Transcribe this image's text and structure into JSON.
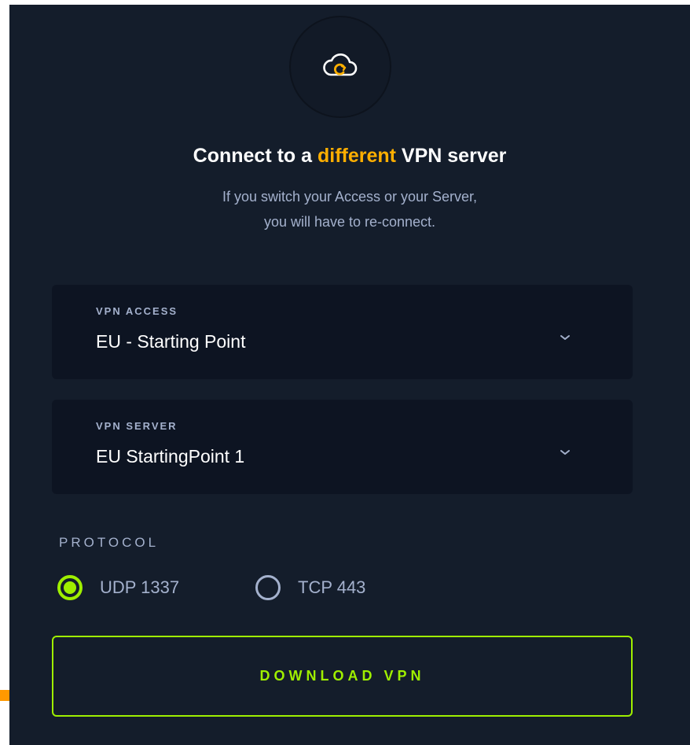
{
  "header": {
    "icon": "cloud-refresh-icon",
    "title_prefix": "Connect to a ",
    "title_highlight": "different",
    "title_suffix": " VPN server",
    "subtitle_line1": "If you switch your Access or your Server,",
    "subtitle_line2": "you will have to re-connect."
  },
  "vpn_access": {
    "label": "VPN ACCESS",
    "value": "EU - Starting Point"
  },
  "vpn_server": {
    "label": "VPN SERVER",
    "value": "EU StartingPoint 1"
  },
  "protocol": {
    "label": "PROTOCOL",
    "options": [
      {
        "label": "UDP 1337",
        "selected": true
      },
      {
        "label": "TCP 443",
        "selected": false
      }
    ]
  },
  "download": {
    "label": "DOWNLOAD VPN"
  },
  "colors": {
    "background": "#141d2b",
    "accent_green": "#9fef00",
    "accent_orange": "#ffaf00",
    "muted_text": "#a4b1cd"
  }
}
